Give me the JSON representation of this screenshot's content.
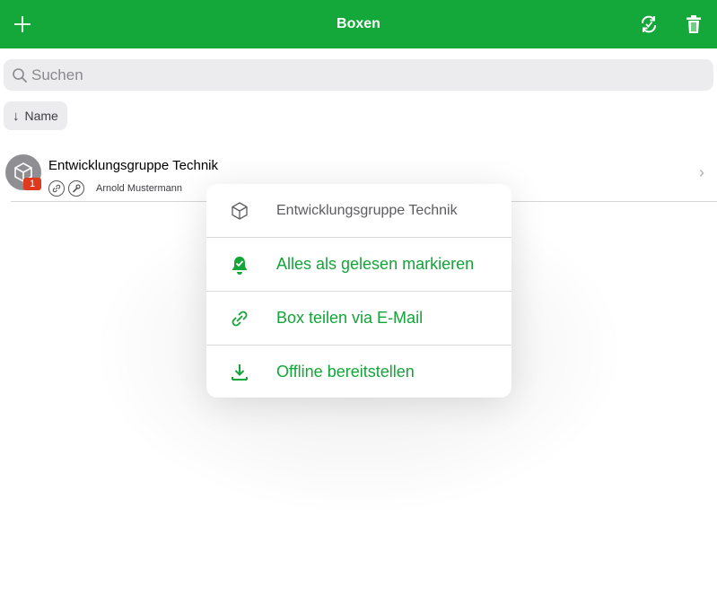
{
  "nav": {
    "title": "Boxen",
    "add_icon": "plus-icon",
    "sync_icon": "sync-icon",
    "delete_icon": "trash-icon",
    "bar_color": "#14a83b"
  },
  "search": {
    "placeholder": "Suchen"
  },
  "sort": {
    "label": "Name",
    "icon": "arrow-down-icon"
  },
  "list": {
    "items": [
      {
        "title": "Entwicklungsgruppe Technik",
        "owner": "Arnold Mustermann",
        "badge": "1",
        "icons": [
          "link-icon",
          "wrench-icon"
        ]
      }
    ]
  },
  "popover": {
    "header": "Entwicklungsgruppe Technik",
    "items": [
      {
        "label": "Alles als gelesen markieren",
        "icon": "bell-check-icon"
      },
      {
        "label": "Box teilen via E-Mail",
        "icon": "link-icon"
      },
      {
        "label": "Offline bereitstellen",
        "icon": "download-icon"
      }
    ],
    "accent_color": "#12a537"
  }
}
